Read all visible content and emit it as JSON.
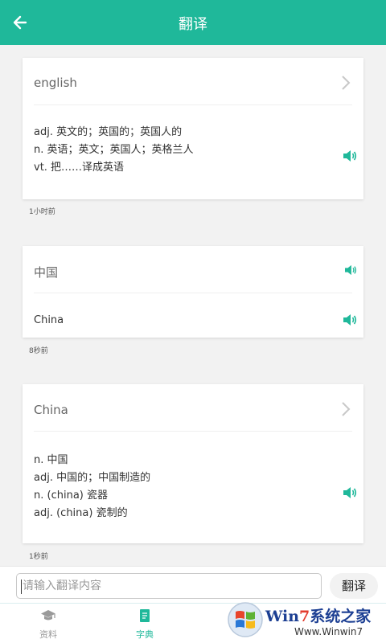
{
  "header": {
    "title": "翻译",
    "back_icon": "arrow-left-icon",
    "background": "#1fb89a"
  },
  "history": [
    {
      "word": "english",
      "definitions": [
        "adj. 英文的；英国的；英国人的",
        "n. 英语；英文；英国人；英格兰人",
        "vt. 把……译成英语"
      ],
      "time": "1小时前"
    },
    {
      "word": "中国",
      "translation": "China",
      "time": "8秒前"
    },
    {
      "word": "China",
      "definitions": [
        "n. 中国",
        "adj. 中国的；中国制造的",
        "n. (china) 瓷器",
        "adj. (china) 瓷制的"
      ],
      "time": "1秒前"
    }
  ],
  "input": {
    "placeholder": "请输入翻译内容",
    "value": "",
    "button_label": "翻译"
  },
  "tabs": [
    {
      "label": "资料",
      "icon": "graduation-cap-icon",
      "active": false
    },
    {
      "label": "字典",
      "icon": "book-icon",
      "active": true
    },
    {
      "label": "",
      "icon": "",
      "active": false
    },
    {
      "label": "",
      "icon": "",
      "active": false
    }
  ],
  "watermark": {
    "brand_prefix": "Win",
    "brand_seven": "7",
    "brand_suffix": "系统之家",
    "url": "Www.Winwin7"
  },
  "colors": {
    "accent": "#1fb89a",
    "tab_inactive": "#9a9a9a",
    "tab_active": "#1fb89a"
  }
}
